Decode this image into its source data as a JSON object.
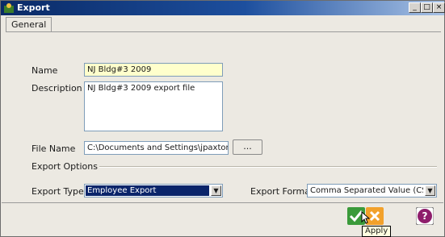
{
  "window": {
    "title": "Export",
    "minimize": "_",
    "maximize": "□",
    "close": "×"
  },
  "tabs": [
    {
      "label": "General"
    }
  ],
  "form": {
    "name_label": "Name",
    "name_value": "NJ Bldg#3 2009",
    "description_label": "Description",
    "description_value": "NJ Bldg#3 2009 export file",
    "filename_label": "File Name",
    "filename_value": "C:\\Documents and Settings\\jpaxton\\My",
    "browse_label": "...",
    "export_options_label": "Export Options",
    "export_type_label": "Export Type",
    "export_type_value": "Employee Export",
    "export_format_label": "Export Format",
    "export_format_value": "Comma Separated Value (CSV) File"
  },
  "footer": {
    "apply_tooltip": "Apply"
  },
  "colors": {
    "ok_green": "#3a9a3a",
    "cancel_orange": "#f2a12b",
    "help_purple": "#8e1d6b",
    "title_blue": "#0a2a66"
  },
  "icons": {
    "title": "export-app-icon",
    "apply": "checkmark-icon",
    "cancel": "cancel-icon",
    "help": "help-icon"
  }
}
